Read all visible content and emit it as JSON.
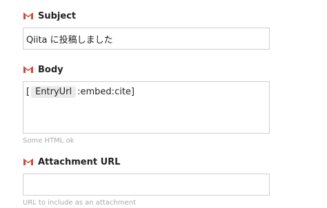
{
  "fields": [
    {
      "label": "Subject",
      "icon": "gmail-icon",
      "value": "Qiita に投稿しました",
      "help": ""
    },
    {
      "label": "Body",
      "icon": "gmail-icon",
      "value_prefix": "[",
      "ingredient": "EntryUrl",
      "value_suffix": ":embed:cite]",
      "help": "Some HTML ok"
    },
    {
      "label": "Attachment URL",
      "icon": "gmail-icon",
      "value": "",
      "help": "URL to include as an attachment"
    }
  ],
  "colors": {
    "gmail_red": "#d44638",
    "input_border": "#cfcfcf",
    "help_text": "#a9a9a9",
    "ingredient_pill": "#ebebeb"
  }
}
